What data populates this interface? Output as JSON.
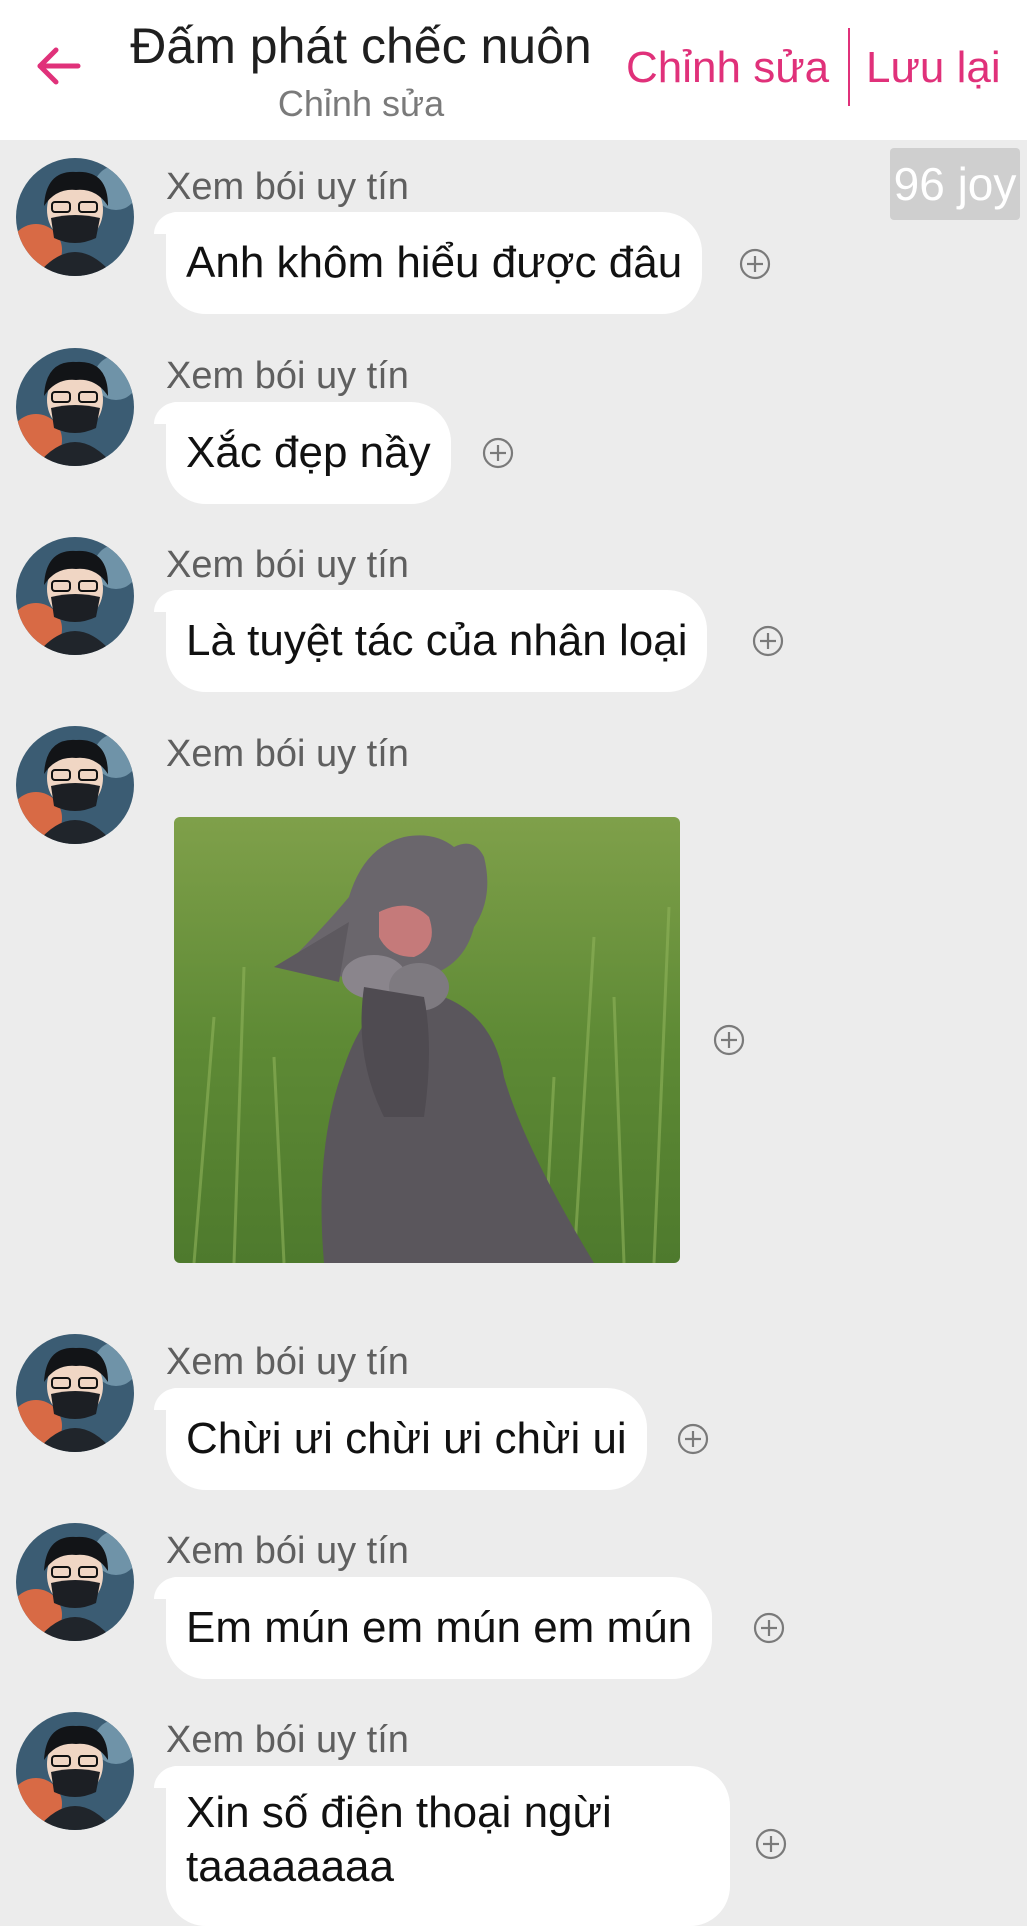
{
  "header": {
    "title": "Đấm phát chếc nuôn",
    "subtitle": "Chỉnh sửa",
    "edit_label": "Chỉnh sửa",
    "save_label": "Lưu lại",
    "accent_color": "#e0317a",
    "back_icon": "arrow-left-icon"
  },
  "counter": "96 joy",
  "messages": [
    {
      "sender": "Xem bói uy tín",
      "text": "Anh khôm hiểu được đâu"
    },
    {
      "sender": "Xem bói uy tín",
      "text": "Xắc đẹp nầy"
    },
    {
      "sender": "Xem bói uy tín",
      "text": "Là tuyệt tác của nhân loại"
    },
    {
      "sender": "Xem bói uy tín",
      "image": "gray cat praying photo"
    },
    {
      "sender": "Xem bói uy tín",
      "text": "Chừi ưi chừi ưi chừi ui"
    },
    {
      "sender": "Xem bói uy tín",
      "text": "Em mún em mún em mún"
    },
    {
      "sender": "Xem bói uy tín",
      "text_line1": "Xin số điện thoại ngừi",
      "text_line2": "taaaaaaaa"
    }
  ],
  "icons": {
    "reaction": "add-reaction-icon",
    "avatar": "user-avatar"
  }
}
